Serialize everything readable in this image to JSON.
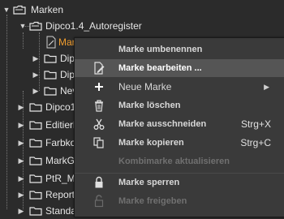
{
  "tree": {
    "items": [
      {
        "label": "Marken",
        "expanded": true,
        "icon": "marker-folder-icon"
      },
      {
        "label": "Dipco1.4_Autoregister",
        "expanded": true,
        "icon": "marker-folder-icon"
      },
      {
        "label": "Marke",
        "selected": true,
        "icon": "marker-document-icon"
      },
      {
        "label": "Dipc",
        "icon": "folder-icon"
      },
      {
        "label": "Dipc",
        "icon": "folder-icon"
      },
      {
        "label": "Nev",
        "icon": "folder-icon"
      },
      {
        "label": "Dipco1",
        "icon": "folder-icon"
      },
      {
        "label": "Editierb",
        "icon": "folder-icon"
      },
      {
        "label": "Farbko",
        "icon": "folder-icon"
      },
      {
        "label": "MarkGr",
        "icon": "folder-icon"
      },
      {
        "label": "PtR_Ma",
        "icon": "folder-icon"
      },
      {
        "label": "Report",
        "icon": "folder-icon"
      },
      {
        "label": "Standa",
        "icon": "folder-icon"
      }
    ],
    "selected_color": "#f29e2e"
  },
  "context_menu": {
    "items": [
      {
        "label": "Marke umbenennen",
        "icon": "rename-icon",
        "enabled": true
      },
      {
        "label": "Marke bearbeiten ...",
        "icon": "edit-document-icon",
        "enabled": true,
        "highlighted": true
      },
      {
        "label": "Neue Marke",
        "icon": "plus-icon",
        "enabled": true,
        "submenu": true
      },
      {
        "label": "Marke löschen",
        "icon": "trash-icon",
        "enabled": true
      },
      {
        "label": "Marke ausschneiden",
        "icon": "scissors-icon",
        "enabled": true,
        "shortcut": "Strg+X"
      },
      {
        "label": "Marke kopieren",
        "icon": "copy-icon",
        "enabled": true,
        "shortcut": "Strg+C"
      },
      {
        "label": "Kombimarke aktualisieren",
        "icon": "none",
        "enabled": false
      },
      {
        "label": "Marke sperren",
        "icon": "lock-icon",
        "enabled": true
      },
      {
        "label": "Marke freigeben",
        "icon": "unlock-icon",
        "enabled": false
      }
    ],
    "submenu_arrow": "▶"
  }
}
